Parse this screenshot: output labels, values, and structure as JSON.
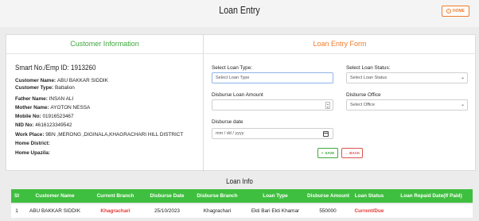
{
  "header": {
    "title": "Loan Entry",
    "home_label": "HOME"
  },
  "customer": {
    "section_title": "Customer Information",
    "emp_id": "Smart No./Emp ID: 1913260",
    "lines": [
      {
        "key": "Customer Name: ",
        "value": "ABU BAKKAR SIDDIK"
      },
      {
        "key": "Customer Type: ",
        "value": "Battalion"
      },
      {
        "key": "Father Name: ",
        "value": "INSAN ALI"
      },
      {
        "key": "Mother Name: ",
        "value": "AYOTON NESSA"
      },
      {
        "key": "Mobile No: ",
        "value": "01916523467"
      },
      {
        "key": "NID No: ",
        "value": "4616123349542"
      },
      {
        "key": "Work Place: ",
        "value": "9BN ,MERONG ,DIGINALA,KHAGRACHARI HILL DISTRICT"
      },
      {
        "key": "Home District: ",
        "value": ""
      },
      {
        "key": "Home Upazila: ",
        "value": ""
      }
    ]
  },
  "form": {
    "section_title": "Loan Entry Form",
    "loan_type_label": "Select Loan Type:",
    "loan_type_value": "Select Loan Type",
    "loan_status_label": "Select Loan Status:",
    "loan_status_value": "Select Loan Status",
    "amount_label": "Disburse Loan Amount",
    "office_label": "Disburse Office",
    "office_value": "Select Office",
    "date_label": "Disburse date",
    "date_placeholder": "mm / dd / yyyy",
    "save_label": "SAVE",
    "back_label": "BACK"
  },
  "loan_info": {
    "title": "Loan Info",
    "columns": [
      "Sl",
      "Customer Name",
      "Current Branch",
      "Disburse Date",
      "Disburse Branch",
      "Loan Type",
      "Disburse Amount",
      "Loan Status",
      "Loan Repaid Date(If Paid)"
    ],
    "rows": [
      [
        "1",
        "ABU BAKKAR SIDDIK",
        "Khagrachari",
        "25/10/2023",
        "Khagrachari",
        "Ekti Bari Ekti Khamar",
        "550000",
        "Current/Due",
        ""
      ]
    ]
  },
  "colors": {
    "accent_orange": "#f07b2c",
    "accent_green": "#3fbf3f",
    "status_red": "#e53935"
  }
}
